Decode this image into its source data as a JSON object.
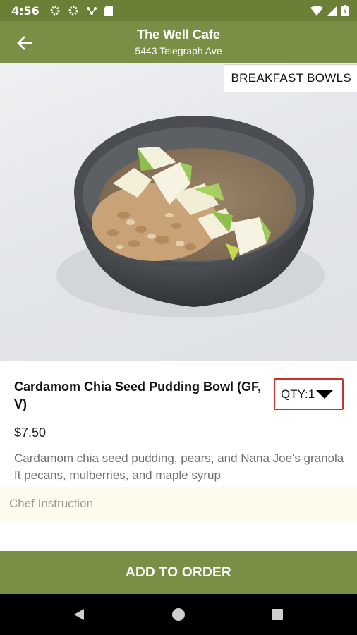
{
  "status_bar": {
    "time": "4:56",
    "icons_left": [
      "gear-icon",
      "gear-icon",
      "network-icon",
      "sd-card-icon"
    ],
    "icons_right": [
      "wifi-icon",
      "signal-icon",
      "battery-icon"
    ]
  },
  "app_bar": {
    "title": "The Well Cafe",
    "subtitle": "5443 Telegraph Ave",
    "back_icon": "arrow-left-icon"
  },
  "hero": {
    "category": "BREAKFAST BOWLS",
    "image_alt": "chia seed pudding bowl with pears and granola"
  },
  "item": {
    "name": "Cardamom Chia Seed Pudding Bowl (GF, V)",
    "qty_label": "QTY:1",
    "price": "$7.50",
    "description": "Cardamom chia seed pudding, pears, and Nana Joe's granola ft pecans, mulberries, and maple syrup"
  },
  "chef_instruction": {
    "placeholder": "Chef Instruction",
    "value": ""
  },
  "actions": {
    "add_to_order": "ADD TO ORDER"
  },
  "colors": {
    "status_bar": "#6c7f36",
    "app_bar": "#7a8f45",
    "qty_border": "#c9332b",
    "chef_bg": "#fdfcec"
  }
}
